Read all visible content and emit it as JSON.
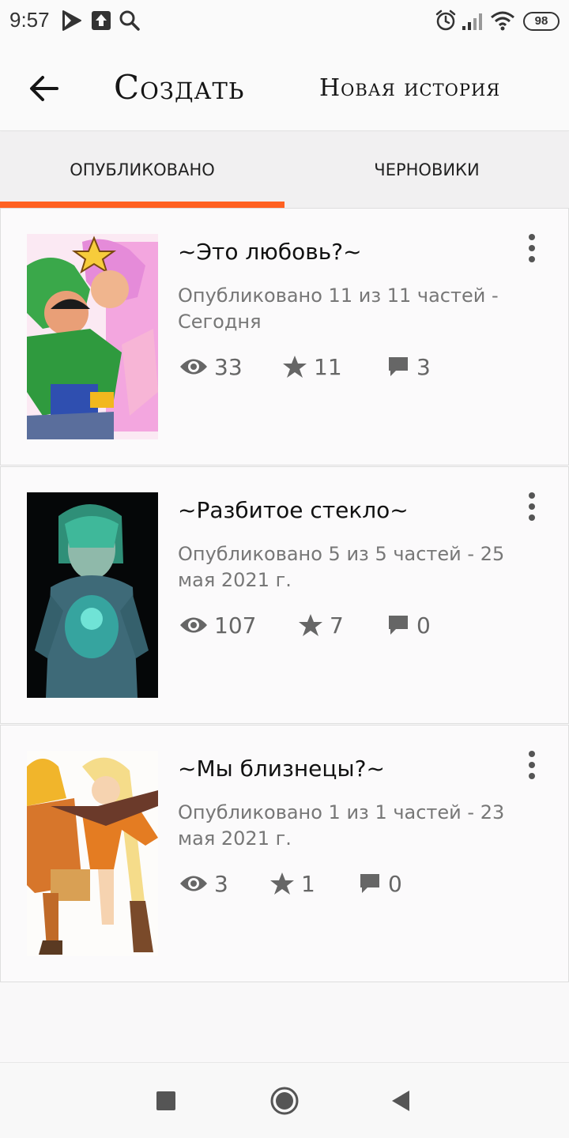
{
  "status_bar": {
    "time": "9:57",
    "battery": "98",
    "icons": [
      "play-store-icon",
      "upload-icon",
      "search-icon",
      "alarm-icon",
      "signal-icon",
      "wifi-icon",
      "battery-icon"
    ]
  },
  "app_bar": {
    "title": "Создать",
    "new_story": "Новая история"
  },
  "tabs": {
    "published": "ОПУБЛИКОВАНО",
    "drafts": "ЧЕРНОВИКИ",
    "active": "published"
  },
  "colors": {
    "accent": "#ff6122",
    "meta_text": "#777777",
    "title_text": "#111111"
  },
  "stories": [
    {
      "title": "~Это любовь?~",
      "meta": "Опубликовано 11 из 11 частей - Сегодня",
      "views": "33",
      "votes": "11",
      "comments": "3"
    },
    {
      "title": "~Разбитое стекло~",
      "meta": "Опубликовано 5 из 5 частей - 25 мая 2021 г.",
      "views": "107",
      "votes": "7",
      "comments": "0"
    },
    {
      "title": "~Мы близнецы?~",
      "meta": "Опубликовано 1 из 1 частей - 23 мая 2021 г.",
      "views": "3",
      "votes": "1",
      "comments": "0"
    }
  ]
}
